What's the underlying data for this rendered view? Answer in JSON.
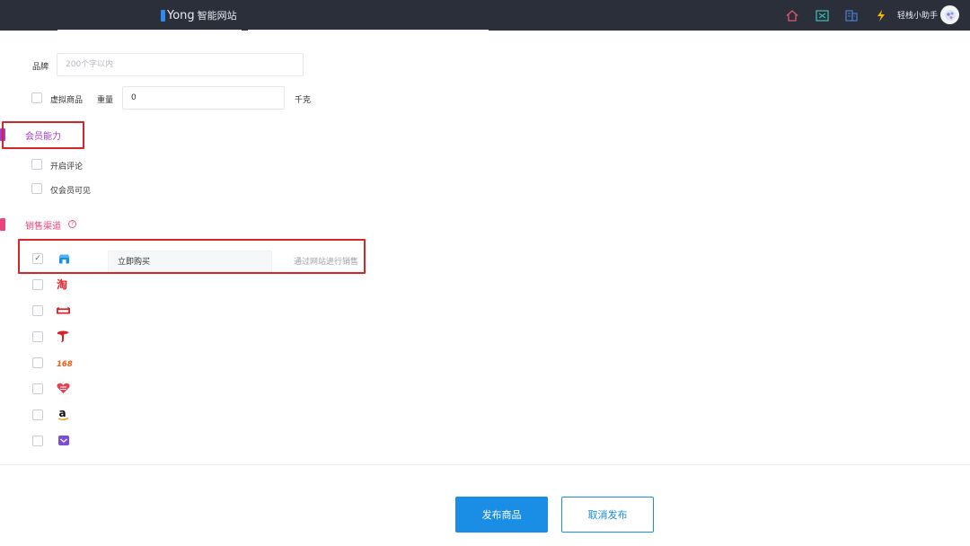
{
  "header": {
    "brand_name": "Yong",
    "brand_sub": "智能网站",
    "icons": [
      "home-icon",
      "screen-icon",
      "building-icon",
      "lightning-icon"
    ],
    "helper_label": "轻栈小助手"
  },
  "form": {
    "brand_label": "品牌",
    "brand_placeholder": "200个字以内",
    "virtual_label": "虚拟商品",
    "weight_label": "重量",
    "weight_value": "0",
    "weight_unit": "千克"
  },
  "member": {
    "title": "会员能力",
    "options": [
      {
        "label": "开启评论",
        "checked": false
      },
      {
        "label": "仅会员可见",
        "checked": false
      }
    ]
  },
  "sales": {
    "title": "销售渠道",
    "help_icon": "question-circle-icon",
    "channels": [
      {
        "icon": "store-icon",
        "checked": true,
        "name": "立即购买",
        "desc": "通过网站进行销售"
      },
      {
        "icon": "taobao-icon",
        "checked": false
      },
      {
        "icon": "tmall-icon",
        "checked": false
      },
      {
        "icon": "jd-icon",
        "checked": false
      },
      {
        "icon": "1688-icon",
        "checked": false
      },
      {
        "icon": "youzan-icon",
        "checked": false
      },
      {
        "icon": "amazon-icon",
        "checked": false
      },
      {
        "icon": "weidian-icon",
        "checked": false
      }
    ]
  },
  "footer": {
    "publish_label": "发布商品",
    "cancel_label": "取消发布"
  },
  "colors": {
    "accent": "#1a8ee5",
    "section_member": "#a03ccf",
    "section_sales": "#e8457a",
    "highlight": "#d3262b"
  }
}
